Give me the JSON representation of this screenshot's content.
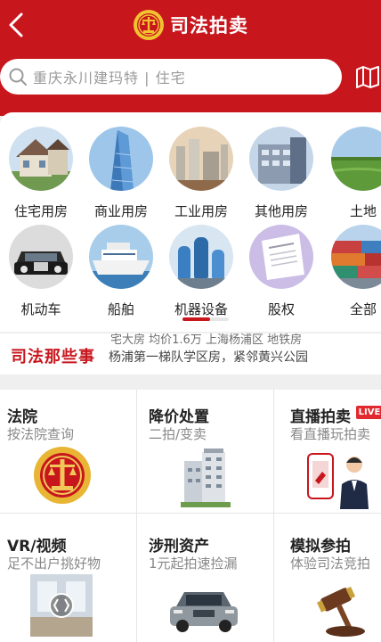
{
  "header": {
    "title": "司法拍卖",
    "colors": {
      "brand": "#c8161d",
      "background": "#efefef"
    }
  },
  "search": {
    "placeholder": "重庆永川建玛特 | 住宅"
  },
  "categories": [
    {
      "label": "住宅用房",
      "icon": "house-photo"
    },
    {
      "label": "商业用房",
      "icon": "skyscraper-photo"
    },
    {
      "label": "工业用房",
      "icon": "factory-photo"
    },
    {
      "label": "其他用房",
      "icon": "building-photo"
    },
    {
      "label": "土地",
      "icon": "land-photo"
    },
    {
      "label": "机动车",
      "icon": "car-photo"
    },
    {
      "label": "船舶",
      "icon": "ship-photo"
    },
    {
      "label": "机器设备",
      "icon": "machinery-photo"
    },
    {
      "label": "股权",
      "icon": "document-photo"
    },
    {
      "label": "全部",
      "icon": "containers-photo"
    }
  ],
  "category_scroll": {
    "fraction": 0.6
  },
  "news": {
    "label": "司法那些事",
    "line1": "宅大房 均价1.6万 上海杨浦区 地铁房",
    "line2": "杨浦第一梯队学区房，紧邻黄兴公园"
  },
  "services": [
    {
      "title": "法院",
      "subtitle": "按法院查询",
      "icon": "court-emblem-icon"
    },
    {
      "title": "降价处置",
      "subtitle": "二拍/变卖",
      "icon": "apartment-building-image"
    },
    {
      "title": "直播拍卖",
      "subtitle": "看直播玩拍卖",
      "icon": "live-presenter-image",
      "badge": "LIVE"
    },
    {
      "title": "VR/视频",
      "subtitle": "足不出户挑好物",
      "icon": "vr-room-image"
    },
    {
      "title": "涉刑资产",
      "subtitle": "1元起拍速捡漏",
      "icon": "suv-image"
    },
    {
      "title": "模拟参拍",
      "subtitle": "体验司法竞拍",
      "icon": "gavel-image"
    }
  ]
}
